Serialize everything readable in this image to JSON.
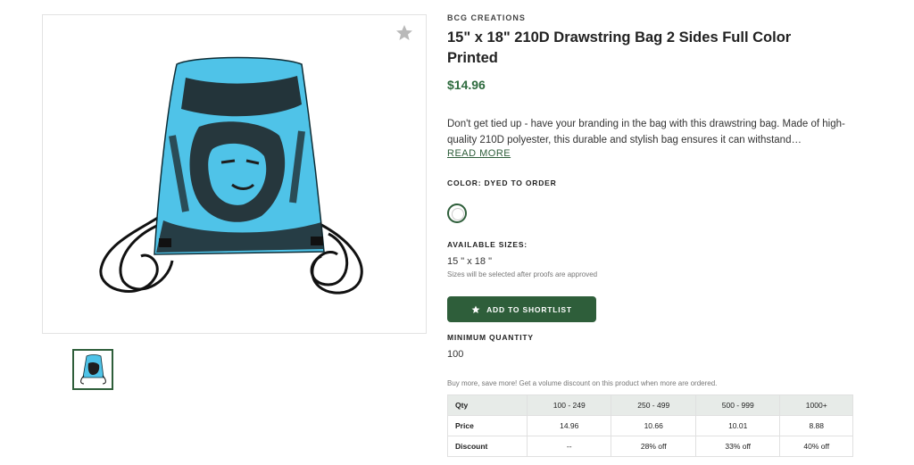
{
  "product": {
    "brand": "BCG CREATIONS",
    "title": "15\" x 18\" 210D Drawstring Bag 2 Sides Full Color Printed",
    "price": "$14.96",
    "description": "Don't get tied up - have your branding in the bag with this drawstring bag. Made of high-quality 210D polyester, this durable and stylish bag ensures it can withstand…",
    "read_more": "READ MORE",
    "color_label": "COLOR: DYED TO ORDER",
    "sizes_label": "AVAILABLE SIZES:",
    "size_value": "15 \" x 18 \"",
    "size_note": "Sizes will be selected after proofs are approved",
    "shortlist_button": "ADD TO SHORTLIST",
    "min_qty_label": "MINIMUM QUANTITY",
    "min_qty_value": "100",
    "volume_note": "Buy more, save more! Get a volume discount on this product when more are ordered."
  },
  "pricing_table": {
    "rows": [
      [
        "Qty",
        "100 - 249",
        "250 - 499",
        "500 - 999",
        "1000+"
      ],
      [
        "Price",
        "14.96",
        "10.66",
        "10.01",
        "8.88"
      ],
      [
        "Discount",
        "--",
        "28% off",
        "33% off",
        "40% off"
      ]
    ]
  },
  "icons": {
    "favorite": "star-icon",
    "shortlist": "star-icon"
  },
  "colors": {
    "accent": "#2e5e3a",
    "price": "#2e6b3e",
    "bag": "#4fc3e8"
  }
}
